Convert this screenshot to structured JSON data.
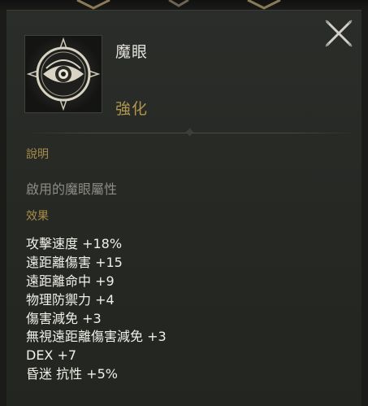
{
  "item": {
    "name": "魔眼",
    "type": "強化",
    "icon": "eye-emblem-icon"
  },
  "close_icon": "close-icon",
  "description": {
    "label": "說明",
    "text": "啟用的魔眼屬性"
  },
  "effects": {
    "label": "效果",
    "stats": [
      "攻擊速度 +18%",
      "遠距離傷害 +15",
      "遠距離命中 +9",
      "物理防禦力 +4",
      "傷害減免 +3",
      "無視遠距離傷害減免 +3",
      "DEX +7",
      "昏迷 抗性 +5%"
    ]
  },
  "colors": {
    "accent_gold": "#a88d4a",
    "name_text": "#e4e2dc",
    "stat_text": "#f0efea",
    "desc_text": "#8d8c87"
  }
}
